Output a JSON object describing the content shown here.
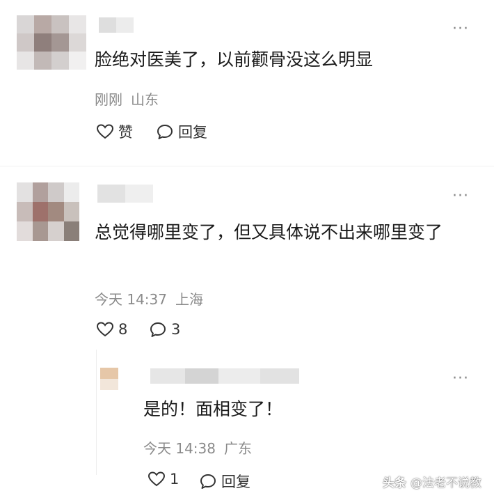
{
  "comments": [
    {
      "text": "脸绝对医美了，以前颧骨没这么明显",
      "time": "刚刚",
      "location": "山东",
      "like_label": "赞",
      "reply_label": "回复",
      "more": "···"
    },
    {
      "text": "总觉得哪里变了，但又具体说不出来哪里变了",
      "time": "今天 14:37",
      "location": "上海",
      "like_count": "8",
      "reply_count": "3",
      "more": "···"
    },
    {
      "text": "是的！面相变了！",
      "time": "今天 14:38",
      "location": "广东",
      "like_count": "1",
      "reply_label": "回复",
      "more": "···"
    }
  ],
  "watermark": {
    "logo": "头条",
    "account": "@法老不说教"
  },
  "colors": {
    "meta": "#8a8a8a",
    "text": "#1b1b1b"
  }
}
